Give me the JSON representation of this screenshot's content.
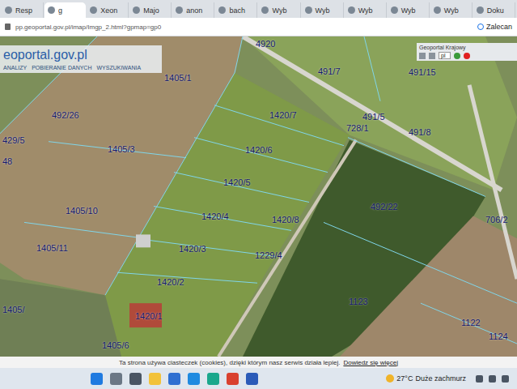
{
  "browser": {
    "tabs": [
      {
        "label": "Resp",
        "selected": false
      },
      {
        "label": "g",
        "selected": true
      },
      {
        "label": "Xeon",
        "selected": false
      },
      {
        "label": "Majo",
        "selected": false
      },
      {
        "label": "anon",
        "selected": false
      },
      {
        "label": "bach",
        "selected": false
      },
      {
        "label": "Wyb",
        "selected": false
      },
      {
        "label": "Wyb",
        "selected": false
      },
      {
        "label": "Wyb",
        "selected": false
      },
      {
        "label": "Wyb",
        "selected": false
      },
      {
        "label": "Wyb",
        "selected": false
      },
      {
        "label": "Doku",
        "selected": false
      }
    ],
    "address": "pp.geoportal.gov.pl/imap/Imgp_2.html?gpmap=gp0",
    "toolbar_button": "Zalecan"
  },
  "map_header": {
    "logo": "eoportal.gov.pl",
    "menu": [
      "ANALIZY",
      "POBIERANIE DANYCH",
      "WYSZUKIWANIA"
    ]
  },
  "overview": {
    "title": "Geoportal Krajowy",
    "language": "pl"
  },
  "parcels": [
    {
      "label": "1405/1"
    },
    {
      "label": "4920"
    },
    {
      "label": "491/7"
    },
    {
      "label": "491/15"
    },
    {
      "label": "492/26"
    },
    {
      "label": "429/5"
    },
    {
      "label": "48"
    },
    {
      "label": "1420/7"
    },
    {
      "label": "491/5"
    },
    {
      "label": "728/1"
    },
    {
      "label": "491/8"
    },
    {
      "label": "1405/3"
    },
    {
      "label": "1420/6"
    },
    {
      "label": "1420/5"
    },
    {
      "label": "492/22"
    },
    {
      "label": "1405/10"
    },
    {
      "label": "1420/4"
    },
    {
      "label": "1420/8"
    },
    {
      "label": "706/2"
    },
    {
      "label": "1405/11"
    },
    {
      "label": "1420/3"
    },
    {
      "label": "1229/4"
    },
    {
      "label": "1420/2"
    },
    {
      "label": "1123"
    },
    {
      "label": "1420/1"
    },
    {
      "label": "1122"
    },
    {
      "label": "1124"
    },
    {
      "label": "1405/"
    },
    {
      "label": "1405/6"
    }
  ],
  "cookie_bar": {
    "text": "Ta strona używa ciasteczek (cookies), dzięki którym nasz serwis działa lepiej.",
    "link": "Dowiedz się więcej"
  },
  "taskbar": {
    "weather": "27°C",
    "weather_text": "Duże zachmurz"
  }
}
